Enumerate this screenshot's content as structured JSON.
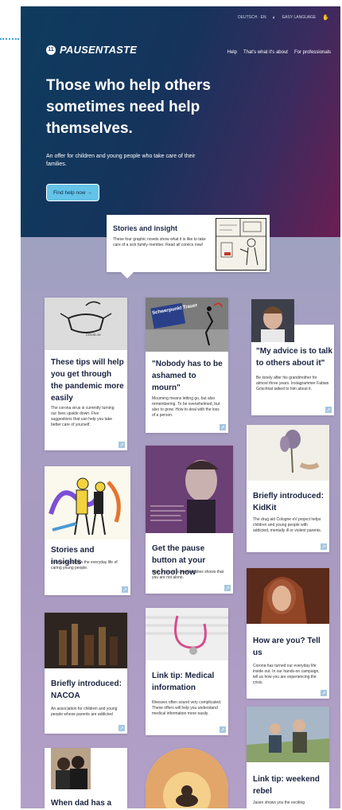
{
  "util": {
    "lang": "DEUTSCH · EN",
    "easy": "EASY LANGUAGE"
  },
  "logo": {
    "mark": "11",
    "text": "PAUSENTASTE"
  },
  "nav": {
    "items": [
      "Help",
      "That's what it's about",
      "For professionals"
    ]
  },
  "hero": {
    "headline": "Those who help others sometimes need help themselves.",
    "sub": "An offer for children and young people who take care of their families.",
    "cta": "Find help now →"
  },
  "stories": {
    "title": "Stories and insight",
    "desc": "These four graphic novels show what it is like to take care of a sick family member. Read all comics now!"
  },
  "cards": [
    {
      "title": "These tips will help you get through the pandemic more easily",
      "text": "The corona virus is currently turning our lives upside down. Five suggestions that can help you take better care of yourself."
    },
    {
      "title": "Stories and insights",
      "text": "Four comics show the everyday life of caring young people."
    },
    {
      "title": "Briefly introduced: NACOA",
      "text": "An association for children and young people whose parents are addicted"
    },
    {
      "title": "When dad has a",
      "text": ""
    },
    {
      "title": "\"Nobody has to be ashamed to mourn\"",
      "text": "Mourning means letting go, but also remembering. To be overwhelmed, but also to grow. How to deal with the loss of a person.",
      "img_label": "Schwerpunkt Trauer"
    },
    {
      "title": "Get the pause button at your school now",
      "text": "How a box of school supplies shows that you are not alone."
    },
    {
      "title": "Link tip: Medical information",
      "text": "Illnesses often sound very complicated. These offers will help you understand medical information more easily."
    },
    {
      "title": "\"My advice is to talk to others about it\"",
      "text": "Be lonely after his grandmother for almost three years. Instagrammer Fabian Grischkat talked to him about it."
    },
    {
      "title": "Briefly introduced: KidKit",
      "text": "The drug aid Cologne eV project helps children and young people with addicted, mentally ill or violent parents."
    },
    {
      "title": "How are you? Tell us",
      "text": "Corona has turned our everyday life inside out. In our hands-on campaign, tell us how you are experiencing the crisis."
    },
    {
      "title": "Link tip: weekend rebel",
      "text": "Jasen shows you the exciting"
    }
  ],
  "covid_label": "COVID-19",
  "colors": {
    "hero_start": "#0e3b5e",
    "hero_end": "#6b1e52",
    "cta": "#63c3e8",
    "title": "#1a2340"
  }
}
